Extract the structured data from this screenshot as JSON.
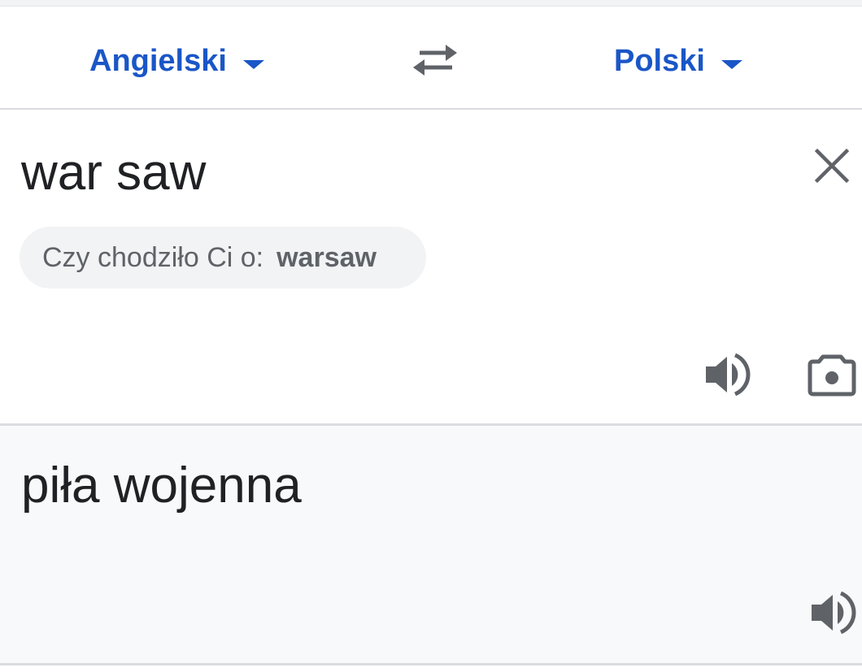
{
  "languages": {
    "source": "Angielski",
    "target": "Polski"
  },
  "input": {
    "text": "war saw",
    "suggestion_prefix": "Czy chodziło Ci o:",
    "suggestion_word": "warsaw"
  },
  "output": {
    "text": "piła wojenna"
  },
  "icons": {
    "dropdown": "caret-down-icon",
    "swap": "swap-arrows-icon",
    "clear": "close-icon",
    "speak": "speaker-icon",
    "camera": "camera-icon"
  },
  "colors": {
    "accent": "#1a56c7",
    "text": "#202124",
    "secondary_text": "#5f6368",
    "icon": "#5f6368",
    "output_background": "#f8f9fa",
    "chip_background": "#f1f3f4",
    "divider": "#dadce0"
  }
}
